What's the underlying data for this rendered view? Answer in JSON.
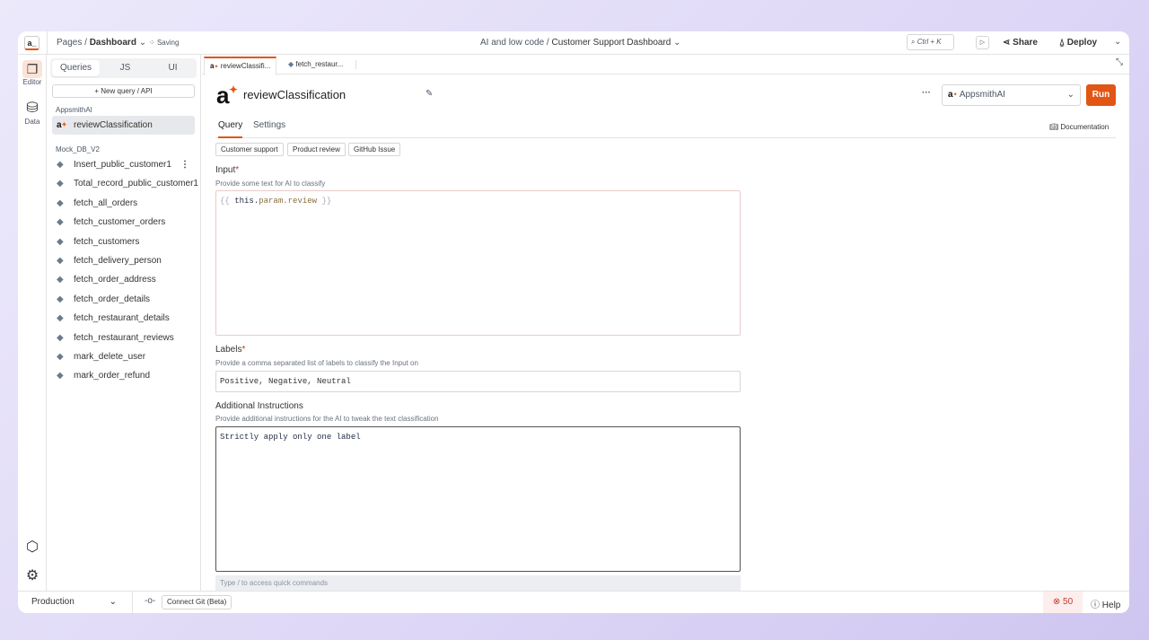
{
  "header": {
    "pages_prefix": "Pages /",
    "page_name": "Dashboard",
    "saving": "Saving",
    "app_prefix": "AI and low code /",
    "app_name": "Customer Support Dashboard",
    "search_shortcut": "Ctrl + K",
    "share": "Share",
    "deploy": "Deploy",
    "logo": "a_"
  },
  "rail": {
    "editor": "Editor",
    "data": "Data"
  },
  "sidebar": {
    "tabs": [
      "Queries",
      "JS",
      "UI"
    ],
    "new_query": "New query / API",
    "groups": [
      {
        "name": "AppsmithAI",
        "items": [
          "reviewClassification"
        ]
      },
      {
        "name": "Mock_DB_V2",
        "items": [
          "Insert_public_customer1",
          "Total_record_public_customer1",
          "fetch_all_orders",
          "fetch_customer_orders",
          "fetch_customers",
          "fetch_delivery_person",
          "fetch_order_address",
          "fetch_order_details",
          "fetch_restaurant_details",
          "fetch_restaurant_reviews",
          "mark_delete_user",
          "mark_order_refund"
        ]
      }
    ]
  },
  "file_tabs": [
    "reviewClassifi...",
    "fetch_restaur..."
  ],
  "query": {
    "name": "reviewClassification",
    "datasource": "AppsmithAI",
    "run": "Run",
    "tabs": [
      "Query",
      "Settings"
    ],
    "documentation": "Documentation",
    "templates": [
      "Customer support",
      "Product review",
      "GitHub Issue"
    ],
    "input_label": "Input",
    "input_help": "Provide some text for AI to classify",
    "input_value": {
      "open": "{{",
      "expr1": "this.",
      "expr2": "param.review",
      "close": "}}"
    },
    "labels_label": "Labels",
    "labels_help": "Provide a comma separated list of labels to classify the Input on",
    "labels_value": "Positive, Negative, Neutral",
    "instr_label": "Additional Instructions",
    "instr_help": "Provide additional instructions for the AI to tweak the text classification",
    "instr_value": "Strictly apply only one label",
    "quick_hint": "Type / to access quick commands"
  },
  "bottom": {
    "env": "Production",
    "git": "Connect Git (Beta)",
    "errors": "50",
    "help": "Help"
  },
  "colors": {
    "accent": "#e15615"
  }
}
